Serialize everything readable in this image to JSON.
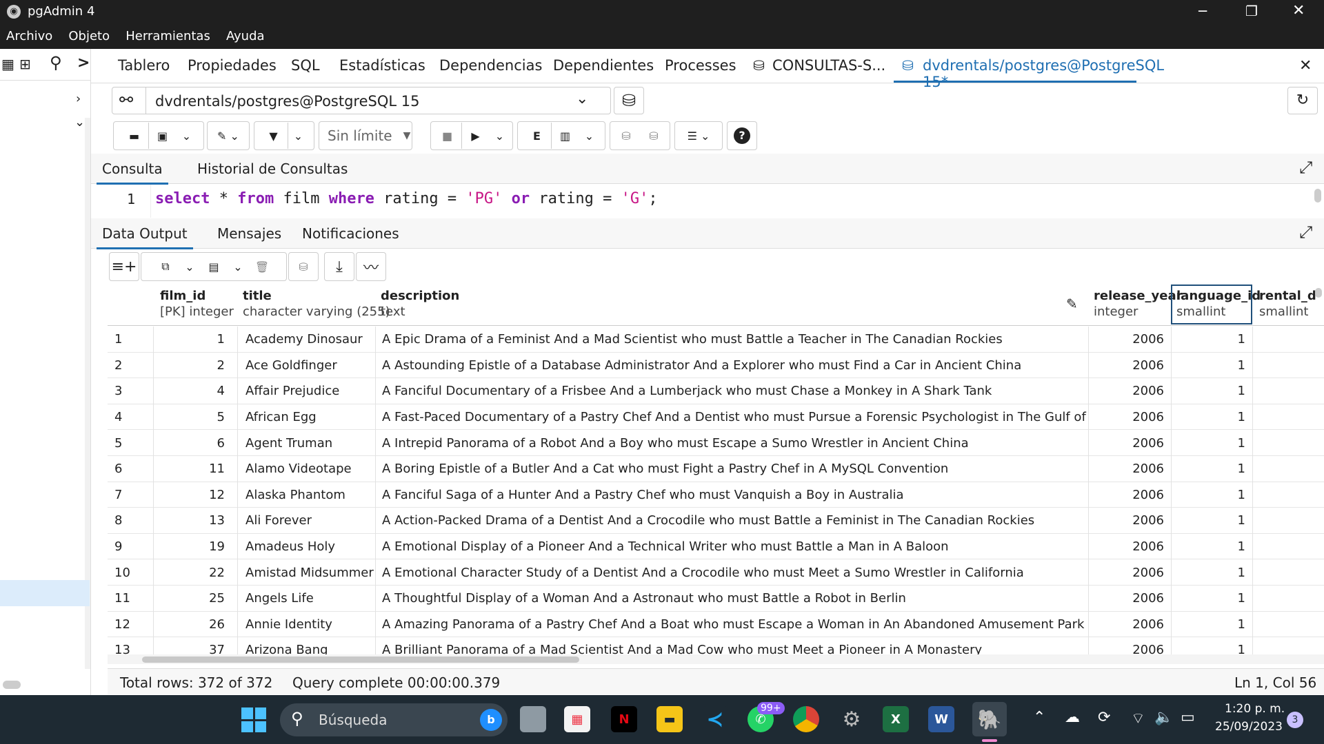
{
  "window": {
    "title": "pgAdmin 4",
    "min": "─",
    "max": "❐",
    "close": "✕"
  },
  "menu": [
    "Archivo",
    "Objeto",
    "Herramientas",
    "Ayuda"
  ],
  "tabs": {
    "items": [
      "Tablero",
      "Propiedades",
      "SQL",
      "Estadísticas",
      "Dependencias",
      "Dependientes",
      "Processes",
      "CONSULTAS-S..."
    ],
    "active": "dvdrentals/postgres@PostgreSQL 15*",
    "close": "✕"
  },
  "connection": {
    "value": "dvdrentals/postgres@PostgreSQL 15"
  },
  "toolbar": {
    "limit": "Sin límite"
  },
  "query_tabs": [
    "Consulta",
    "Historial de Consultas"
  ],
  "editor": {
    "line_no": "1",
    "tokens": [
      {
        "t": "select",
        "c": "kw"
      },
      {
        "t": " * ",
        "c": ""
      },
      {
        "t": "from",
        "c": "kw"
      },
      {
        "t": " film ",
        "c": ""
      },
      {
        "t": "where",
        "c": "kw"
      },
      {
        "t": " rating = ",
        "c": ""
      },
      {
        "t": "'PG'",
        "c": "str"
      },
      {
        "t": " ",
        "c": ""
      },
      {
        "t": "or",
        "c": "kw"
      },
      {
        "t": " rating = ",
        "c": ""
      },
      {
        "t": "'G'",
        "c": "str"
      },
      {
        "t": ";",
        "c": ""
      }
    ]
  },
  "output_tabs": [
    "Data Output",
    "Mensajes",
    "Notificaciones"
  ],
  "columns": [
    {
      "name": "film_id",
      "type": "[PK] integer"
    },
    {
      "name": "title",
      "type": "character varying (255)"
    },
    {
      "name": "description",
      "type": "text"
    },
    {
      "name": "release_year",
      "type": "integer"
    },
    {
      "name": "language_id",
      "type": "smallint"
    },
    {
      "name": "rental_du",
      "type": "smallint"
    }
  ],
  "rows": [
    [
      "1",
      "1",
      "Academy Dinosaur",
      "A Epic Drama of a Feminist And a Mad Scientist who must Battle a Teacher in The Canadian Rockies",
      "2006",
      "1"
    ],
    [
      "2",
      "2",
      "Ace Goldfinger",
      "A Astounding Epistle of a Database Administrator And a Explorer who must Find a Car in Ancient China",
      "2006",
      "1"
    ],
    [
      "3",
      "4",
      "Affair Prejudice",
      "A Fanciful Documentary of a Frisbee And a Lumberjack who must Chase a Monkey in A Shark Tank",
      "2006",
      "1"
    ],
    [
      "4",
      "5",
      "African Egg",
      "A Fast-Paced Documentary of a Pastry Chef And a Dentist who must Pursue a Forensic Psychologist in The Gulf of Mexico",
      "2006",
      "1"
    ],
    [
      "5",
      "6",
      "Agent Truman",
      "A Intrepid Panorama of a Robot And a Boy who must Escape a Sumo Wrestler in Ancient China",
      "2006",
      "1"
    ],
    [
      "6",
      "11",
      "Alamo Videotape",
      "A Boring Epistle of a Butler And a Cat who must Fight a Pastry Chef in A MySQL Convention",
      "2006",
      "1"
    ],
    [
      "7",
      "12",
      "Alaska Phantom",
      "A Fanciful Saga of a Hunter And a Pastry Chef who must Vanquish a Boy in Australia",
      "2006",
      "1"
    ],
    [
      "8",
      "13",
      "Ali Forever",
      "A Action-Packed Drama of a Dentist And a Crocodile who must Battle a Feminist in The Canadian Rockies",
      "2006",
      "1"
    ],
    [
      "9",
      "19",
      "Amadeus Holy",
      "A Emotional Display of a Pioneer And a Technical Writer who must Battle a Man in A Baloon",
      "2006",
      "1"
    ],
    [
      "10",
      "22",
      "Amistad Midsummer",
      "A Emotional Character Study of a Dentist And a Crocodile who must Meet a Sumo Wrestler in California",
      "2006",
      "1"
    ],
    [
      "11",
      "25",
      "Angels Life",
      "A Thoughtful Display of a Woman And a Astronaut who must Battle a Robot in Berlin",
      "2006",
      "1"
    ],
    [
      "12",
      "26",
      "Annie Identity",
      "A Amazing Panorama of a Pastry Chef And a Boat who must Escape a Woman in An Abandoned Amusement Park",
      "2006",
      "1"
    ],
    [
      "13",
      "37",
      "Arizona Bang",
      "A Brilliant Panorama of a Mad Scientist And a Mad Cow who must Meet a Pioneer in A Monastery",
      "2006",
      "1"
    ]
  ],
  "status": {
    "rows": "Total rows: 372 of 372",
    "query": "Query complete 00:00:00.379",
    "position": "Ln 1, Col 56"
  },
  "taskbar": {
    "search": "Búsqueda",
    "whatsapp_badge": "99+",
    "time": "1:20 p. m.",
    "date": "25/09/2023",
    "notif": "3",
    "colors": {
      "taskbar": "#1e2a33",
      "accent": "#1f6fb2",
      "netflix": "#e50914",
      "excel": "#1d6f42",
      "word": "#2b579a"
    }
  }
}
